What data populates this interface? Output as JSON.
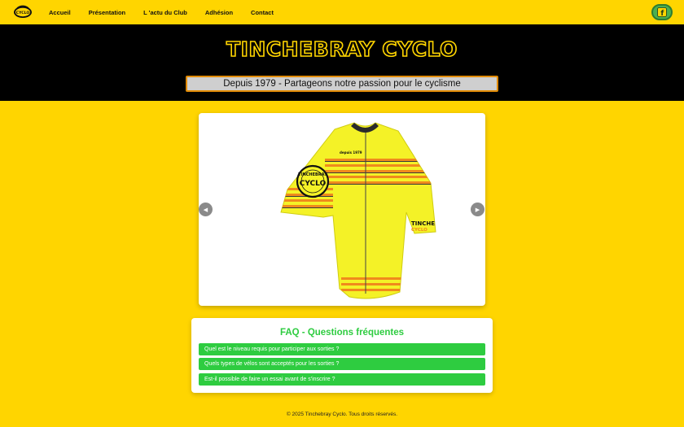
{
  "nav": {
    "logo_text": "CYCLO",
    "links": [
      "Accueil",
      "Présentation",
      "L 'actu du Club",
      "Adhésion",
      "Contact"
    ],
    "facebook_glyph": "f"
  },
  "hero": {
    "title": "TINCHEBRAY CYCLO",
    "tagline": "Depuis 1979 - Partageons notre passion pour le cyclisme"
  },
  "carousel": {
    "jersey": {
      "badge_top": "TINCHEBRAY",
      "badge_main": "CYCLO",
      "since": "depuis 1979",
      "sleeve_top": "TINCHE",
      "sleeve_bottom": "CYCLO"
    },
    "prev_glyph": "◀",
    "next_glyph": "▶"
  },
  "faq": {
    "title": "FAQ - Questions fréquentes",
    "items": [
      "Quel est le niveau requis pour participer aux sorties ?",
      "Quels types de vélos sont acceptés pour les sorties ?",
      "Est-il possible de faire un essai avant de s'inscrire ?"
    ]
  },
  "footer": {
    "text": "© 2025 Tinchebray Cyclo. Tous droits réservés."
  },
  "colors": {
    "page_bg": "#ffd500",
    "hero_bg": "#000000",
    "faq_accent": "#2ecc40",
    "jersey_yellow": "#f4f227",
    "stripe_orange": "#f08a1c"
  }
}
